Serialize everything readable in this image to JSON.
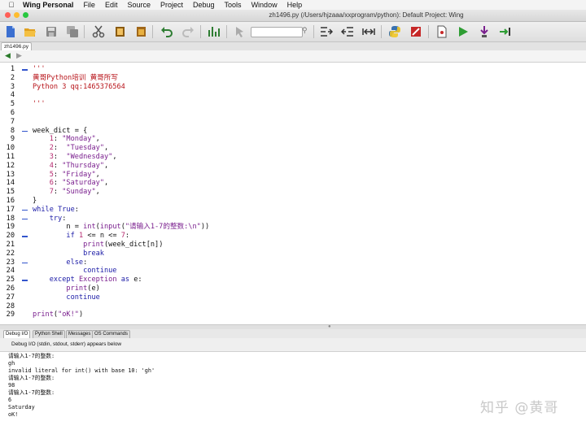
{
  "menubar": {
    "app": "Wing Personal",
    "items": [
      "File",
      "Edit",
      "Source",
      "Project",
      "Debug",
      "Tools",
      "Window",
      "Help"
    ]
  },
  "window": {
    "title": "zh1496.py (/Users/hjzaaa/xxprogram/python): Default Project: Wing"
  },
  "editor_tab": "zh1496.py",
  "code_lines": [
    {
      "n": "1",
      "html": "<span class='cm'>'''</span>"
    },
    {
      "n": "2",
      "html": "<span class='cm'>黄哥Python培训 黄哥所写</span>"
    },
    {
      "n": "3",
      "html": "<span class='cm'>Python 3 qq:1465376564</span>"
    },
    {
      "n": "4",
      "html": ""
    },
    {
      "n": "5",
      "html": "<span class='cm'>'''</span>"
    },
    {
      "n": "6",
      "html": ""
    },
    {
      "n": "7",
      "html": ""
    },
    {
      "n": "8",
      "html": "week_dict = {"
    },
    {
      "n": "9",
      "html": "    <span class='nm'>1</span>: <span class='st'>\"Monday\"</span>,"
    },
    {
      "n": "10",
      "html": "    <span class='nm'>2</span>:  <span class='st'>\"Tuesday\"</span>,"
    },
    {
      "n": "11",
      "html": "    <span class='nm'>3</span>:  <span class='st'>\"Wednesday\"</span>,"
    },
    {
      "n": "12",
      "html": "    <span class='nm'>4</span>: <span class='st'>\"Thursday\"</span>,"
    },
    {
      "n": "13",
      "html": "    <span class='nm'>5</span>: <span class='st'>\"Friday\"</span>,"
    },
    {
      "n": "14",
      "html": "    <span class='nm'>6</span>: <span class='st'>\"Saturday\"</span>,"
    },
    {
      "n": "15",
      "html": "    <span class='nm'>7</span>: <span class='st'>\"Sunday\"</span>,"
    },
    {
      "n": "16",
      "html": "}"
    },
    {
      "n": "17",
      "html": "<span class='kw'>while</span> <span class='kw'>True</span>:"
    },
    {
      "n": "18",
      "html": "    <span class='kw'>try</span>:"
    },
    {
      "n": "19",
      "html": "        n = <span class='bi'>int</span>(<span class='bi'>input</span>(<span class='st'>\"请输入1-7的整数:\\n\"</span>))"
    },
    {
      "n": "20",
      "html": "        <span class='kw'>if</span> <span class='nm'>1</span> &lt;= n &lt;= <span class='nm'>7</span>:"
    },
    {
      "n": "21",
      "html": "            <span class='bi'>print</span>(week_dict[n])"
    },
    {
      "n": "22",
      "html": "            <span class='kw'>break</span>"
    },
    {
      "n": "23",
      "html": "        <span class='kw'>else</span>:"
    },
    {
      "n": "24",
      "html": "            <span class='kw'>continue</span>"
    },
    {
      "n": "25",
      "html": "    <span class='kw'>except</span> <span class='bi'>Exception</span> <span class='kw'>as</span> e:"
    },
    {
      "n": "26",
      "html": "        <span class='bi'>print</span>(e)"
    },
    {
      "n": "27",
      "html": "        <span class='kw'>continue</span>"
    },
    {
      "n": "28",
      "html": ""
    },
    {
      "n": "29",
      "html": "<span class='bi'>print</span>(<span class='st'>\"oK!\"</span>)"
    }
  ],
  "bottom_tabs": [
    "Debug I/O",
    "Python Shell",
    "Messages",
    "OS Commands"
  ],
  "debug_header": "Debug I/O (stdin, stdout, stderr) appears below",
  "output_lines": [
    "请输入1-7的整数:",
    "gh",
    "invalid literal for int() with base 10: 'gh'",
    "请输入1-7的整数:",
    "98",
    "请输入1-7的整数:",
    "6",
    "Saturday",
    "oK!"
  ],
  "watermark": "知乎 @黄哥",
  "colors": {
    "keyword": "#1a1aa6",
    "string": "#7a1f8e",
    "number": "#b5286e",
    "comment": "#b8151b"
  }
}
